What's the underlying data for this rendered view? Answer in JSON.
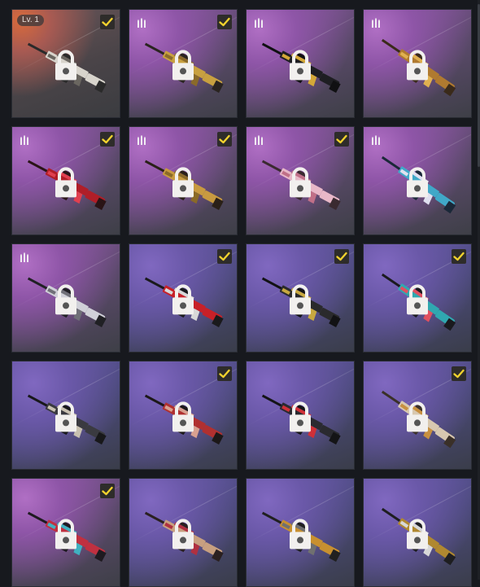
{
  "level_badge": "Lv. 1",
  "colors": {
    "check": "#f2d22e",
    "lock": "#ffffff"
  },
  "icons": {
    "locked": "padlock-icon",
    "owned": "checkmark-icon",
    "tier": "ammo-tier-icon"
  },
  "skins": [
    {
      "bg": "orange",
      "level": true,
      "tier": false,
      "check": true,
      "gun": {
        "body": "#d8d4cc",
        "accent": "#6a6660",
        "dark": "#2a2a2a"
      }
    },
    {
      "bg": "purple",
      "level": false,
      "tier": true,
      "check": true,
      "gun": {
        "body": "#c8a040",
        "accent": "#8a6a2a",
        "dark": "#2a2420"
      }
    },
    {
      "bg": "purple",
      "level": false,
      "tier": true,
      "check": false,
      "gun": {
        "body": "#1e1e22",
        "accent": "#d4a838",
        "dark": "#101012"
      }
    },
    {
      "bg": "purple",
      "level": false,
      "tier": true,
      "check": false,
      "gun": {
        "body": "#b07a30",
        "accent": "#e0b050",
        "dark": "#3a2a1a"
      }
    },
    {
      "bg": "purple",
      "level": false,
      "tier": true,
      "check": true,
      "gun": {
        "body": "#b01e28",
        "accent": "#e04050",
        "dark": "#2a1416"
      }
    },
    {
      "bg": "purple",
      "level": false,
      "tier": true,
      "check": true,
      "gun": {
        "body": "#c89a40",
        "accent": "#8a6a28",
        "dark": "#2a2018"
      }
    },
    {
      "bg": "purple",
      "level": false,
      "tier": true,
      "check": true,
      "gun": {
        "body": "#e8b8c8",
        "accent": "#c07088",
        "dark": "#3a2a30"
      }
    },
    {
      "bg": "purple",
      "level": false,
      "tier": true,
      "check": false,
      "gun": {
        "body": "#40a8c8",
        "accent": "#e0e0f0",
        "dark": "#1a2838"
      }
    },
    {
      "bg": "purple",
      "level": false,
      "tier": true,
      "check": false,
      "gun": {
        "body": "#d0d0d8",
        "accent": "#707078",
        "dark": "#202024"
      }
    },
    {
      "bg": "blue",
      "level": false,
      "tier": false,
      "check": true,
      "gun": {
        "body": "#c82028",
        "accent": "#d8d8d8",
        "dark": "#1a1a1c"
      }
    },
    {
      "bg": "blue",
      "level": false,
      "tier": false,
      "check": true,
      "gun": {
        "body": "#2a2a2c",
        "accent": "#c8a840",
        "dark": "#121214"
      }
    },
    {
      "bg": "blue",
      "level": false,
      "tier": false,
      "check": true,
      "gun": {
        "body": "#30a8b0",
        "accent": "#e05060",
        "dark": "#1a1a1e"
      }
    },
    {
      "bg": "blue",
      "level": false,
      "tier": false,
      "check": false,
      "gun": {
        "body": "#3a3a40",
        "accent": "#c8c0b0",
        "dark": "#18181a"
      }
    },
    {
      "bg": "blue",
      "level": false,
      "tier": false,
      "check": true,
      "gun": {
        "body": "#b03030",
        "accent": "#d8a090",
        "dark": "#1c1818"
      }
    },
    {
      "bg": "blue",
      "level": false,
      "tier": false,
      "check": false,
      "gun": {
        "body": "#2a2a30",
        "accent": "#d03038",
        "dark": "#141416"
      }
    },
    {
      "bg": "blue",
      "level": false,
      "tier": false,
      "check": true,
      "gun": {
        "body": "#d8c8b0",
        "accent": "#c89040",
        "dark": "#3a3028"
      }
    },
    {
      "bg": "purple",
      "level": false,
      "tier": false,
      "check": true,
      "gun": {
        "body": "#c03040",
        "accent": "#40b0c0",
        "dark": "#1e1a20"
      }
    },
    {
      "bg": "blue",
      "level": false,
      "tier": false,
      "check": false,
      "gun": {
        "body": "#c8a080",
        "accent": "#b03040",
        "dark": "#2a2020"
      }
    },
    {
      "bg": "blue",
      "level": false,
      "tier": false,
      "check": false,
      "gun": {
        "body": "#c89030",
        "accent": "#707070",
        "dark": "#202020"
      }
    },
    {
      "bg": "blue",
      "level": false,
      "tier": false,
      "check": false,
      "gun": {
        "body": "#b08830",
        "accent": "#d8d8d8",
        "dark": "#1e1e20"
      }
    }
  ]
}
